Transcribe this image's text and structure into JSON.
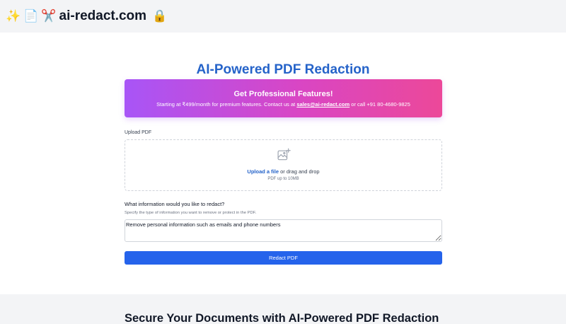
{
  "header": {
    "brand_emojis": [
      "✨",
      "📄",
      "✂️"
    ],
    "brand_name": "ai-redact.com",
    "lock_emoji": "🔒"
  },
  "main": {
    "title": "AI-Powered PDF Redaction",
    "promo": {
      "title": "Get Professional Features!",
      "text_before_email": "Starting at ₹499/month for premium features. Contact us at ",
      "email": "sales@ai-redact.com",
      "text_after_email": " or call +91 80-4680-9825",
      "gradient_start": "#a855f7",
      "gradient_end": "#ec4899"
    },
    "upload": {
      "label": "Upload PDF",
      "link_text": "Upload a file",
      "drop_text": " or drag and drop",
      "hint": "PDF up to 10MB",
      "icon": "image-plus-icon"
    },
    "redact_question": {
      "label": "What information would you like to redact?",
      "hint": "Specify the type of information you want to remove or protect in the PDF.",
      "value": "Remove personal information such as emails and phone numbers"
    },
    "button": {
      "label": "Redact PDF",
      "color": "#2563eb"
    }
  },
  "section2": {
    "title": "Secure Your Documents with AI-Powered PDF Redaction"
  },
  "colors": {
    "accent": "#2563c9",
    "background": "#f3f4f6"
  }
}
